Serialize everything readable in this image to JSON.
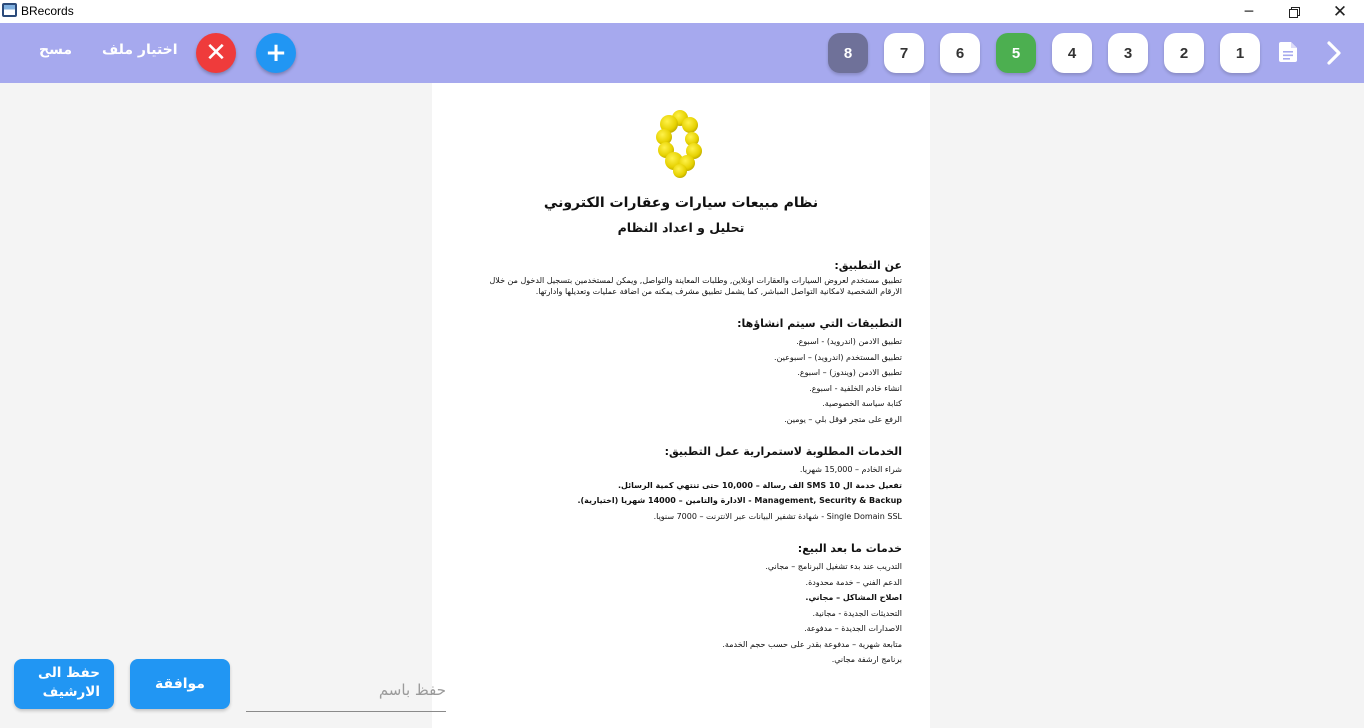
{
  "window": {
    "title": "BRecords"
  },
  "window_controls": {
    "minimize": "─",
    "close": "✕"
  },
  "toolbar": {
    "clear_label": "مسح",
    "pick_file_label": "اختيار ملف",
    "cancel_symbol": "✕",
    "add_symbol": "+",
    "pages": [
      {
        "label": "8",
        "style": "dark"
      },
      {
        "label": "7",
        "style": "normal"
      },
      {
        "label": "6",
        "style": "normal"
      },
      {
        "label": "5",
        "style": "green"
      },
      {
        "label": "4",
        "style": "normal"
      },
      {
        "label": "3",
        "style": "normal"
      },
      {
        "label": "2",
        "style": "normal"
      },
      {
        "label": "1",
        "style": "normal"
      }
    ],
    "accent_color": "#a6a9ee"
  },
  "document": {
    "title": "نظام مبيعات سيارات وعقارات الكتروني",
    "subtitle": "تحليل و اعداد النظام",
    "about": {
      "heading": "عن التطبيق:",
      "text": "تطبيق مستخدم لعروض السيارات والعقارات اونلاين, وطلبات المعاينة والتواصل, ويمكن لمستخدمين بتسجيل الدخول من خلال الارقام الشخصية لامكانية التواصل المباشر, كما يشمل تطبيق مشرف يمكنه من اضافة عمليات وتعديلها وادارتها."
    },
    "apps": {
      "heading": "التطبيقات التي سيتم انشاؤها:",
      "items": [
        {
          "text": "تطبيق الادمن (اندرويد) - اسبوع.",
          "bold": false
        },
        {
          "text": "تطبيق المستخدم (اندرويد) – اسبوعين.",
          "bold": false
        },
        {
          "text": "تطبيق الادمن (ويندوز) – اسبوع.",
          "bold": false
        },
        {
          "text": "انشاء خادم الخلفية - اسبوع.",
          "bold": false
        },
        {
          "text": "كتابة سياسة الخصوصية.",
          "bold": false
        },
        {
          "text": "الرفع على متجر قوقل بلي – يومين.",
          "bold": false
        }
      ]
    },
    "services": {
      "heading": "الخدمات المطلوبة لاستمرارية عمل التطبيق:",
      "items": [
        {
          "text": "شراء الخادم – 15,000 شهريا.",
          "bold": false
        },
        {
          "text": "تفعيل خدمة ال SMS 10 الف رسالة – 10,000 حتى تنتهي كمية الرسائل.",
          "bold": true
        },
        {
          "text": "Management, Security & Backup  -  الادارة والتامين – 14000 شهريا (اختيارية).",
          "bold": true
        },
        {
          "text": "Single Domain SSL  -  شهادة تشفير البيانات عبر الانترنت – 7000 سنويا.",
          "bold": false
        }
      ]
    },
    "after_sales": {
      "heading": "خدمات ما بعد البيع:",
      "items": [
        {
          "text": "التدريب عند بدء تشغيل البرنامج – مجاني.",
          "bold": false
        },
        {
          "text": "الدعم الفني – خدمة محدودة.",
          "bold": false
        },
        {
          "text": "اصلاح المشاكل – مجاني.",
          "bold": true
        },
        {
          "text": "التحديثات الجديدة - مجانية.",
          "bold": false
        },
        {
          "text": "الاصدارات الجديدة – مدفوعة.",
          "bold": false
        },
        {
          "text": "متابعة شهرية – مدفوعة بقدر على حسب حجم الخدمة.",
          "bold": false
        },
        {
          "text": "برنامج ارشفة مجاني.",
          "bold": false
        }
      ]
    }
  },
  "bottom": {
    "archive_label": "حفظ الى الارشيف",
    "ok_label": "موافقة",
    "name_input": {
      "value": "",
      "placeholder": "حفظ باسم"
    }
  }
}
